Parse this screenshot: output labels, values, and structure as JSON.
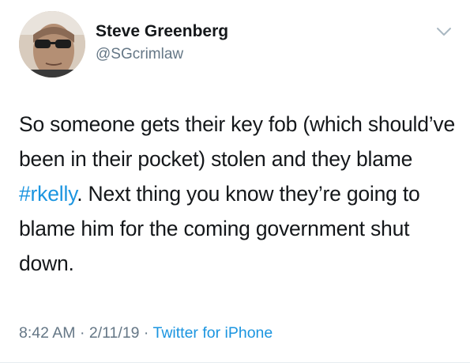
{
  "author": {
    "display_name": "Steve Greenberg",
    "handle": "@SGcrimlaw"
  },
  "tweet": {
    "text_part1": "So someone gets their key fob (which should’ve been in their pocket) stolen and they blame ",
    "hashtag": "#rkelly",
    "text_part2": ". Next thing you know they’re going to blame him for the coming government shut down.",
    "time": "8:42 AM",
    "date": "2/11/19",
    "source": "Twitter for iPhone",
    "separator": " · "
  },
  "icons": {
    "menu": "chevron-down-icon",
    "avatar": "avatar-photo"
  },
  "colors": {
    "primary_text": "#14171a",
    "secondary_text": "#657786",
    "link": "#1b95e0"
  }
}
